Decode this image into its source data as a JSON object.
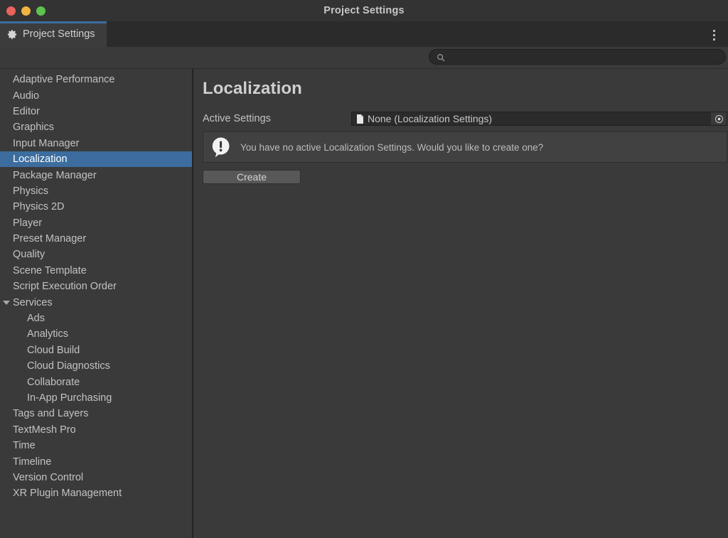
{
  "window": {
    "title": "Project Settings",
    "controls": [
      {
        "name": "close",
        "color": "#e8635a"
      },
      {
        "name": "minimize",
        "color": "#f1b342"
      },
      {
        "name": "maximize",
        "color": "#5dc250"
      }
    ]
  },
  "tabbar": {
    "tab_label": "Project Settings",
    "tab_icon": "gear-icon",
    "accent_color": "#3c6d9e",
    "menu_icon": "kebab-menu-icon"
  },
  "search": {
    "value": "",
    "placeholder": "",
    "icon": "search-icon"
  },
  "sidebar": {
    "items": [
      {
        "label": "Adaptive Performance",
        "selected": false,
        "child": false,
        "expandable": false
      },
      {
        "label": "Audio",
        "selected": false,
        "child": false,
        "expandable": false
      },
      {
        "label": "Editor",
        "selected": false,
        "child": false,
        "expandable": false
      },
      {
        "label": "Graphics",
        "selected": false,
        "child": false,
        "expandable": false
      },
      {
        "label": "Input Manager",
        "selected": false,
        "child": false,
        "expandable": false
      },
      {
        "label": "Localization",
        "selected": true,
        "child": false,
        "expandable": false
      },
      {
        "label": "Package Manager",
        "selected": false,
        "child": false,
        "expandable": false
      },
      {
        "label": "Physics",
        "selected": false,
        "child": false,
        "expandable": false
      },
      {
        "label": "Physics 2D",
        "selected": false,
        "child": false,
        "expandable": false
      },
      {
        "label": "Player",
        "selected": false,
        "child": false,
        "expandable": false
      },
      {
        "label": "Preset Manager",
        "selected": false,
        "child": false,
        "expandable": false
      },
      {
        "label": "Quality",
        "selected": false,
        "child": false,
        "expandable": false
      },
      {
        "label": "Scene Template",
        "selected": false,
        "child": false,
        "expandable": false
      },
      {
        "label": "Script Execution Order",
        "selected": false,
        "child": false,
        "expandable": false
      },
      {
        "label": "Services",
        "selected": false,
        "child": false,
        "expandable": true
      },
      {
        "label": "Ads",
        "selected": false,
        "child": true,
        "expandable": false
      },
      {
        "label": "Analytics",
        "selected": false,
        "child": true,
        "expandable": false
      },
      {
        "label": "Cloud Build",
        "selected": false,
        "child": true,
        "expandable": false
      },
      {
        "label": "Cloud Diagnostics",
        "selected": false,
        "child": true,
        "expandable": false
      },
      {
        "label": "Collaborate",
        "selected": false,
        "child": true,
        "expandable": false
      },
      {
        "label": "In-App Purchasing",
        "selected": false,
        "child": true,
        "expandable": false
      },
      {
        "label": "Tags and Layers",
        "selected": false,
        "child": false,
        "expandable": false
      },
      {
        "label": "TextMesh Pro",
        "selected": false,
        "child": false,
        "expandable": false
      },
      {
        "label": "Time",
        "selected": false,
        "child": false,
        "expandable": false
      },
      {
        "label": "Timeline",
        "selected": false,
        "child": false,
        "expandable": false
      },
      {
        "label": "Version Control",
        "selected": false,
        "child": false,
        "expandable": false
      },
      {
        "label": "XR Plugin Management",
        "selected": false,
        "child": false,
        "expandable": false
      }
    ],
    "selection_color": "#3c6d9e"
  },
  "main": {
    "title": "Localization",
    "active_settings": {
      "label": "Active Settings",
      "value": "None (Localization Settings)",
      "value_icon": "document-icon",
      "picker_icon": "object-picker-icon"
    },
    "helpbox": {
      "icon": "warning-speech-bubble-icon",
      "text": "You have no active Localization Settings. Would you like to create one?"
    },
    "create_button": "Create"
  }
}
